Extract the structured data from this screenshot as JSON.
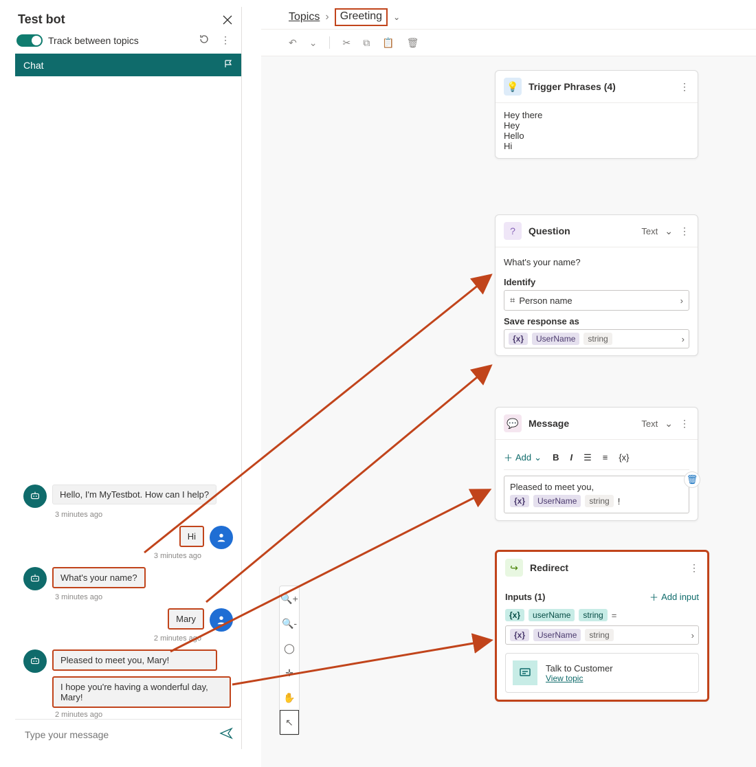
{
  "testbot": {
    "title": "Test bot",
    "track_label": "Track between topics",
    "chat_tab": "Chat",
    "compose_placeholder": "Type your message",
    "transcript": {
      "m1": "Hello, I'm MyTestbot. How can I help?",
      "t1": "3 minutes ago",
      "u1": "Hi",
      "ut1": "3 minutes ago",
      "m2": "What's your name?",
      "t2": "3 minutes ago",
      "u2": "Mary",
      "ut2": "2 minutes ago",
      "m3": "Pleased to meet you, Mary!",
      "m4": "I hope you're having a wonderful day, Mary!",
      "t3": "2 minutes ago"
    }
  },
  "breadcrumb": {
    "root": "Topics",
    "current": "Greeting"
  },
  "nodes": {
    "trigger": {
      "title": "Trigger Phrases (4)",
      "p1": "Hey there",
      "p2": "Hey",
      "p3": "Hello",
      "p4": "Hi"
    },
    "question": {
      "title": "Question",
      "type": "Text",
      "prompt": "What's your name?",
      "identify_label": "Identify",
      "identify_value": "Person name",
      "save_label": "Save response as",
      "var_name": "UserName",
      "var_type": "string"
    },
    "message": {
      "title": "Message",
      "type": "Text",
      "add_label": "Add",
      "text": "Pleased to meet you,",
      "var_name": "UserName",
      "var_type": "string",
      "suffix": "!"
    },
    "redirect": {
      "title": "Redirect",
      "inputs_label": "Inputs (1)",
      "add_input_label": "Add input",
      "in_var": "userName",
      "in_type": "string",
      "out_var": "UserName",
      "out_type": "string",
      "topic_name": "Talk to Customer",
      "topic_link": "View topic"
    }
  }
}
